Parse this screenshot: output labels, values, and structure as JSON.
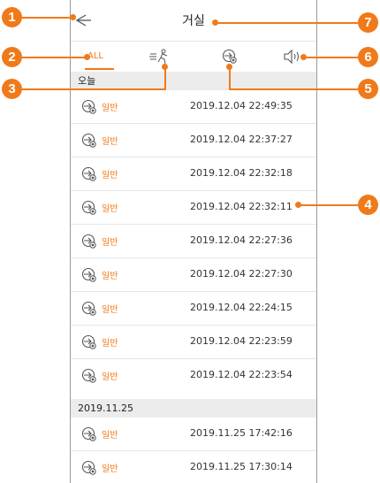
{
  "header": {
    "title": "거실"
  },
  "tabs": {
    "all_label": "ALL"
  },
  "sections": [
    {
      "date": "오늘",
      "items": [
        {
          "type": "일반",
          "time": "2019.12.04 22:49:35"
        },
        {
          "type": "일반",
          "time": "2019.12.04 22:37:27"
        },
        {
          "type": "일반",
          "time": "2019.12.04 22:32:18"
        },
        {
          "type": "일반",
          "time": "2019.12.04 22:32:11"
        },
        {
          "type": "일반",
          "time": "2019.12.04 22:27:36"
        },
        {
          "type": "일반",
          "time": "2019.12.04 22:27:30"
        },
        {
          "type": "일반",
          "time": "2019.12.04 22:24:15"
        },
        {
          "type": "일반",
          "time": "2019.12.04 22:23:59"
        },
        {
          "type": "일반",
          "time": "2019.12.04 22:23:54"
        }
      ]
    },
    {
      "date": "2019.11.25",
      "items": [
        {
          "type": "일반",
          "time": "2019.11.25 17:42:16"
        },
        {
          "type": "일반",
          "time": "2019.11.25 17:30:14"
        }
      ]
    }
  ],
  "callouts": [
    "1",
    "2",
    "3",
    "4",
    "5",
    "6",
    "7"
  ],
  "colors": {
    "accent": "#f07a1a",
    "callout": "#f07a1a",
    "section_bg": "#ececec"
  },
  "icons": {
    "back": "back-arrow-icon",
    "motion": "motion-event-icon",
    "general": "general-event-icon",
    "sound": "sound-event-icon"
  }
}
